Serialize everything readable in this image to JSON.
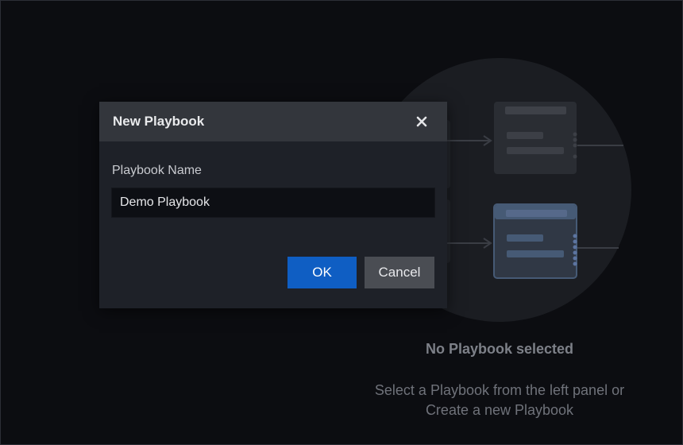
{
  "dialog": {
    "title": "New Playbook",
    "close_icon": "close-icon",
    "field_label": "Playbook Name",
    "field_value": "Demo Playbook",
    "ok_label": "OK",
    "cancel_label": "Cancel"
  },
  "empty_state": {
    "illustration_icon": "playbook-flow-illustration",
    "title": "No Playbook selected",
    "subtitle_line1": "Select a Playbook from the left panel or",
    "subtitle_line2": "Create a new Playbook"
  },
  "colors": {
    "background": "#0c0d11",
    "dialog_body": "#1e2128",
    "dialog_header": "#33363c",
    "primary_button": "#0f5ec3",
    "secondary_button": "#4a4d53",
    "illustration_circle": "#1b1d22",
    "card_highlight": "#465a75"
  }
}
